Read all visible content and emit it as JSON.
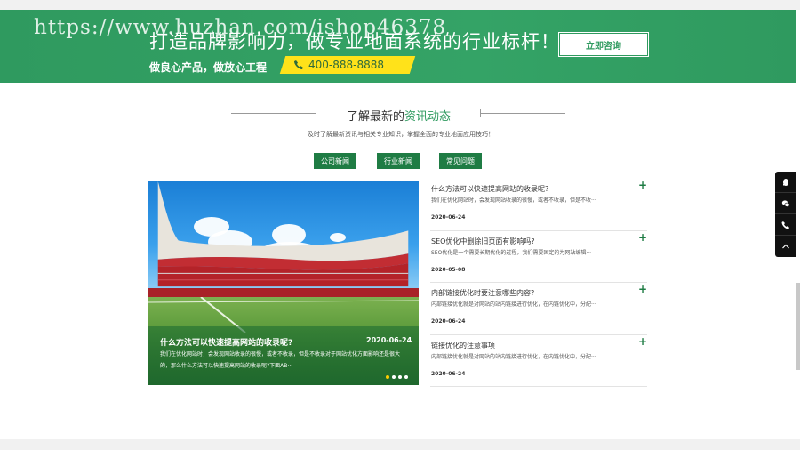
{
  "watermark": "https://www.huzhan.com/ishop46378",
  "banner": {
    "title": "打造品牌影响力，做专业地面系统的行业标杆！",
    "subtitle": "做良心产品，做放心工程",
    "phone": "400-888-8888",
    "consult_button": "立即咨询",
    "phone_icon": "phone-icon",
    "bg_color": "#2f9a5f",
    "accent_color": "#ffe21a"
  },
  "section": {
    "heading_prefix": "了解最新的",
    "heading_highlight": "资讯动态",
    "subheading": "及时了解最新资讯与相关专业知识，掌握全面的专业地面应用技巧！"
  },
  "tabs": [
    {
      "label": "公司新闻"
    },
    {
      "label": "行业新闻"
    },
    {
      "label": "常见问题"
    }
  ],
  "featured": {
    "title": "什么方法可以快速提高网站的收录呢?",
    "date": "2020-06-24",
    "description": "我们在优化网站时，会发现网站收录的很慢，或者不收录，但是不收录对于网站优化方面影响还是很大的，那么什么方法可以快速提高网站的收录呢?下面AB···"
  },
  "news": [
    {
      "title": "什么方法可以快速提高网站的收录呢?",
      "desc": "我们在优化网站时，会发现网站收录的很慢，或者不收录，但是不收···",
      "date": "2020-06-24"
    },
    {
      "title": "SEO优化中删除旧页面有影响吗?",
      "desc": "SEO优化是一个需要长期优化的过程，我们需要固定的为网站编辑···",
      "date": "2020-05-08"
    },
    {
      "title": "内部链接优化时要注意哪些内容?",
      "desc": "内部链接优化就是对网站的站内链接进行优化，在内链优化中，分配···",
      "date": "2020-06-24"
    },
    {
      "title": "链接优化的注意事项",
      "desc": "内部链接优化就是对网站的站内链接进行优化，在内链优化中，分配···",
      "date": "2020-06-24"
    }
  ],
  "sidebar_tools": [
    {
      "icon": "qq-icon"
    },
    {
      "icon": "wechat-icon"
    },
    {
      "icon": "phone-icon"
    },
    {
      "icon": "back-to-top-icon"
    }
  ],
  "plus_symbol": "+",
  "colors": {
    "green": "#2f9a5f",
    "dark_green": "#1f7c44"
  }
}
